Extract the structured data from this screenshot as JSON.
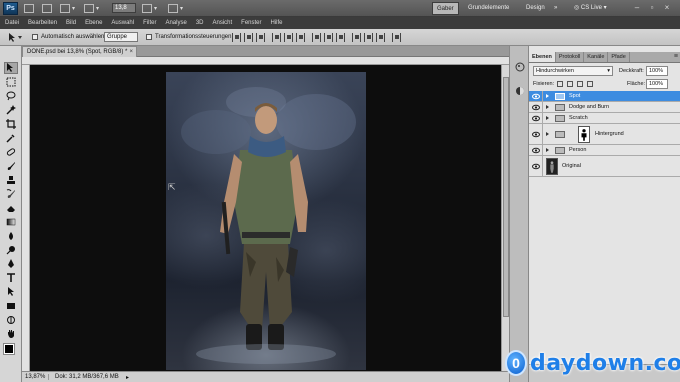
{
  "appbar": {
    "logo": "Ps",
    "zoom": "13,8",
    "workspaces": [
      "Gaber",
      "Grundelemente",
      "Design"
    ],
    "more": "»",
    "cs_live": "CS Live"
  },
  "menu": [
    "Datei",
    "Bearbeiten",
    "Bild",
    "Ebene",
    "Auswahl",
    "Filter",
    "Analyse",
    "3D",
    "Ansicht",
    "Fenster",
    "Hilfe"
  ],
  "options": {
    "auto_select_label": "Automatisch auswählen:",
    "auto_select_value": "Gruppe",
    "transform_label": "Transformationssteuerungen"
  },
  "document": {
    "tab_title": "DONE.psd bei 13,8% (Spot, RGB/8) *",
    "tab_close": "×",
    "status_zoom": "13,87%",
    "status_doc": "Dok: 31,2 MB/367,6 MB",
    "status_arrow": "▸"
  },
  "layers_panel": {
    "tabs": [
      "Ebenen",
      "Protokoll",
      "Kanäle",
      "Pfade"
    ],
    "menu_icon": "≡",
    "blend_mode": "Hindurchwirken",
    "opacity_label": "Deckkraft:",
    "opacity_value": "100%",
    "fix_label": "Fixieren:",
    "fill_label": "Fläche:",
    "fill_value": "100%",
    "layers": [
      {
        "name": "Spot",
        "selected": true
      },
      {
        "name": "Dodge and Burn",
        "selected": false
      },
      {
        "name": "Scratch",
        "selected": false
      },
      {
        "name": "Hintergrund",
        "selected": false
      },
      {
        "name": "Person",
        "selected": false
      },
      {
        "name": "Original",
        "selected": false
      }
    ]
  },
  "watermark": {
    "badge": "0",
    "text": "daydown.com"
  },
  "colors": {
    "selection": "#3d8ce0",
    "watermark": "#1f7fe8"
  }
}
